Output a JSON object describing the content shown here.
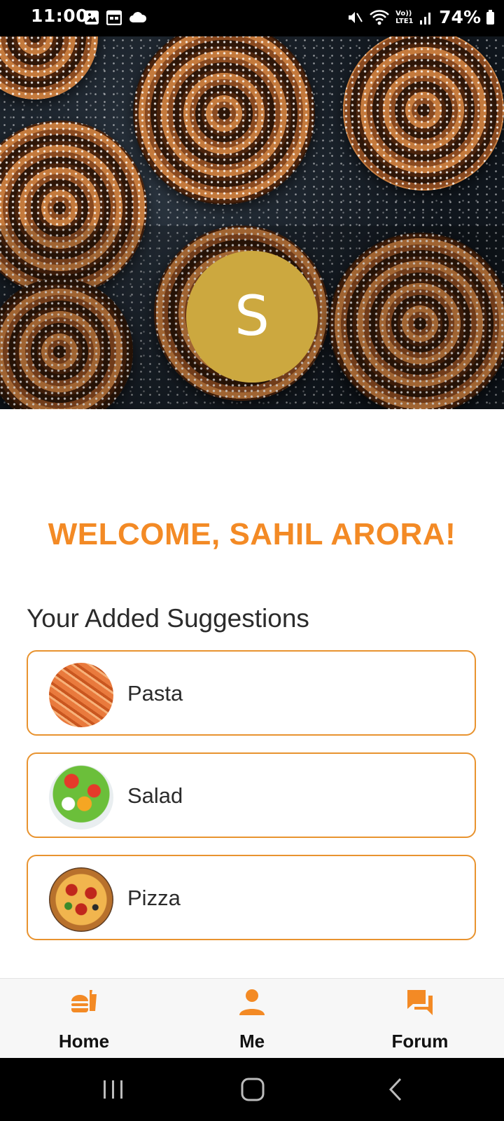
{
  "status_bar": {
    "time": "11:00",
    "battery": "74%",
    "network_label": "Vo)) LTE1"
  },
  "profile": {
    "avatar_initial": "S",
    "avatar_color": "#cca83f"
  },
  "welcome_text": "WELCOME, SAHIL ARORA!",
  "accent_color": "#f38a25",
  "section_title": "Your Added Suggestions",
  "suggestions": [
    {
      "label": "Pasta",
      "image": "pasta"
    },
    {
      "label": "Salad",
      "image": "salad"
    },
    {
      "label": "Pizza",
      "image": "pizza"
    }
  ],
  "bottom_nav": {
    "items": [
      {
        "label": "Home",
        "icon": "fastfood-icon"
      },
      {
        "label": "Me",
        "icon": "person-icon"
      },
      {
        "label": "Forum",
        "icon": "forum-icon"
      }
    ]
  }
}
